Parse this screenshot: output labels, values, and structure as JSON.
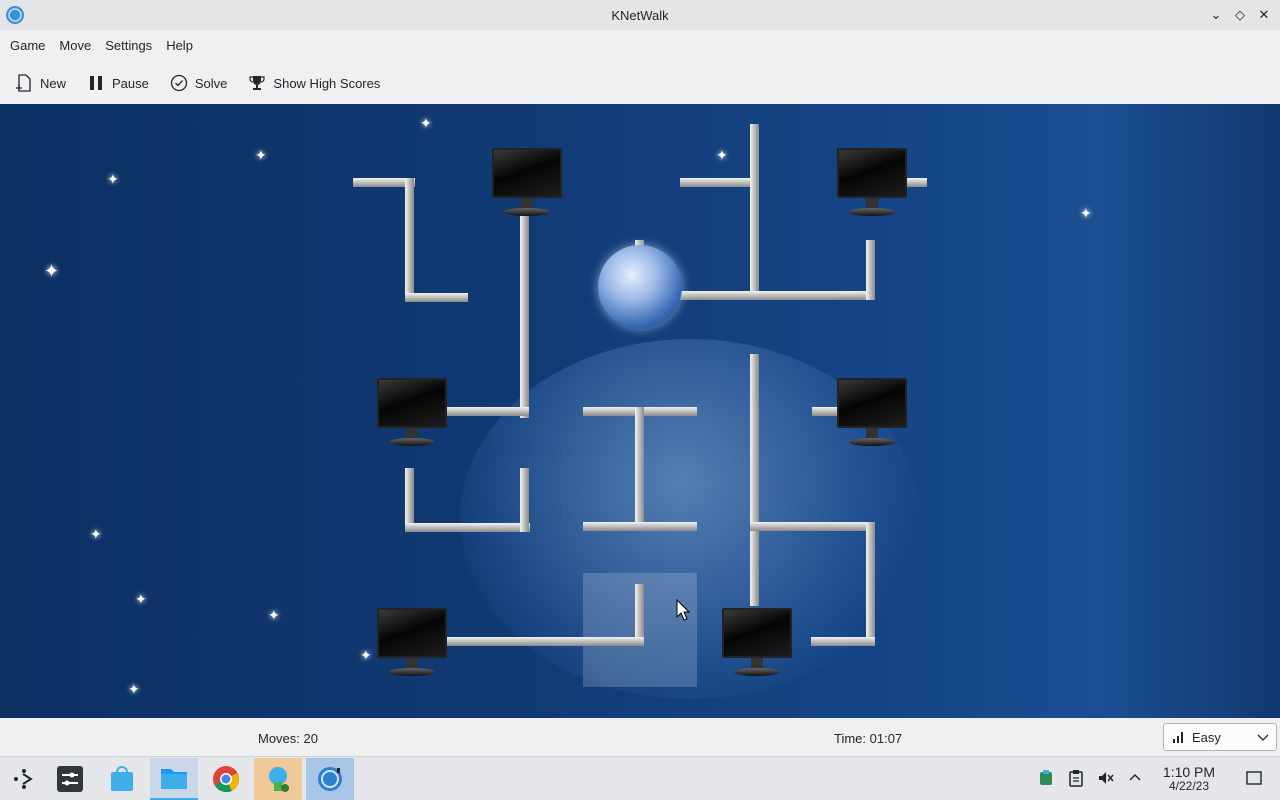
{
  "window": {
    "title": "KNetWalk"
  },
  "menu": [
    "Game",
    "Move",
    "Settings",
    "Help"
  ],
  "toolbar": {
    "new": "New",
    "pause": "Pause",
    "solve": "Solve",
    "high_scores": "Show High Scores"
  },
  "status": {
    "moves": "Moves: 20",
    "time": "Time: 01:07",
    "difficulty": "Easy"
  },
  "taskbar": {
    "clock_time": "1:10 PM",
    "clock_date": "4/22/23"
  },
  "colors": {
    "board_bg": "#113a74",
    "accent": "#3daee9"
  }
}
